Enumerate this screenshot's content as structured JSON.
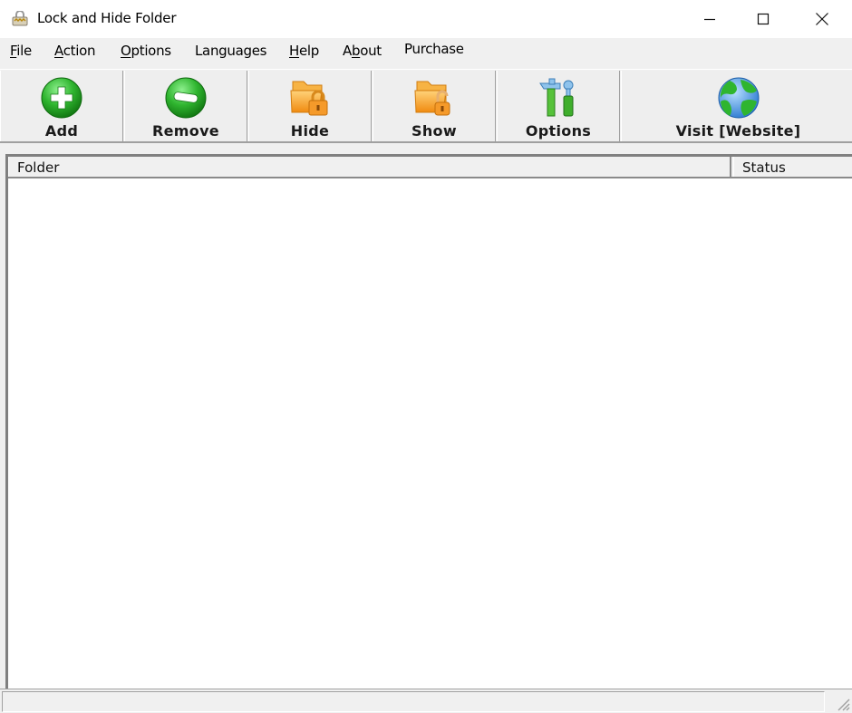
{
  "window": {
    "title": "Lock and Hide Folder",
    "icon": "lock-folder-app-icon",
    "controls": {
      "minimize": "minimize-icon",
      "maximize": "maximize-icon",
      "close": "close-icon"
    }
  },
  "menubar": {
    "items": [
      {
        "label": "File",
        "mnemonic": "F"
      },
      {
        "label": "Action",
        "mnemonic": "A"
      },
      {
        "label": "Options",
        "mnemonic": "O"
      },
      {
        "label": "Languages",
        "mnemonic": ""
      },
      {
        "label": "Help",
        "mnemonic": "H"
      },
      {
        "label": "About",
        "mnemonic": "b"
      },
      {
        "label": "Purchase",
        "mnemonic": ""
      }
    ]
  },
  "toolbar": {
    "buttons": [
      {
        "label": "Add",
        "icon": "add-plus-circle-icon"
      },
      {
        "label": "Remove",
        "icon": "remove-minus-circle-icon"
      },
      {
        "label": "Hide",
        "icon": "folder-lock-closed-icon"
      },
      {
        "label": "Show",
        "icon": "folder-lock-open-icon"
      },
      {
        "label": "Options",
        "icon": "tools-hammer-screwdriver-icon"
      },
      {
        "label": "Visit [Website]",
        "icon": "globe-icon"
      }
    ]
  },
  "list": {
    "columns": [
      "Folder",
      "Status"
    ],
    "rows": []
  },
  "statusbar": {
    "text": ""
  },
  "colors": {
    "accent_green": "#2fae2f",
    "folder_orange": "#f5a623",
    "globe_blue": "#3a8fe0",
    "chrome_bg": "#f0f0f0"
  }
}
